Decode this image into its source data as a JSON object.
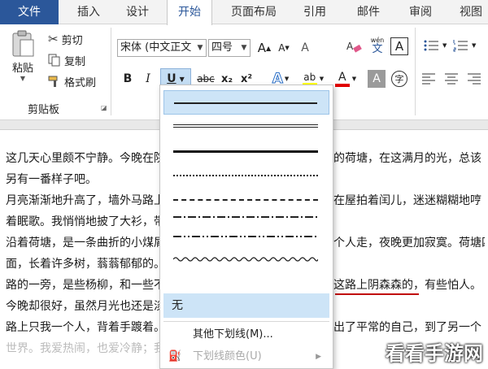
{
  "tabs": {
    "file": "文件",
    "insert": "插入",
    "design": "设计",
    "home": "开始",
    "layout": "页面布局",
    "references": "引用",
    "mailings": "邮件",
    "review": "审阅",
    "view": "视图"
  },
  "clipboard": {
    "paste": "粘贴",
    "cut": "剪切",
    "copy": "复制",
    "format_painter": "格式刷",
    "group_label": "剪贴板"
  },
  "font": {
    "name": "宋体 (中文正文",
    "size": "四号",
    "bold": "B",
    "italic": "I",
    "underline": "U",
    "strike": "abc",
    "sub": "x₂",
    "sup": "x²",
    "grow": "A",
    "shrink": "A",
    "text_a": "A",
    "wen": "wén",
    "wen_char": "文",
    "border_a": "A",
    "shade_a": "A",
    "circle_char": "字",
    "effects_a": "A",
    "highlight_a": "ab",
    "color_a": "A"
  },
  "colors": {
    "accent": "#2b579a",
    "underline_red": "#c00000",
    "hover": "#cde4f7",
    "highlight": "#ffff00",
    "font_red": "#e00000"
  },
  "underline_menu": {
    "none": "无",
    "more": "其他下划线(M)...",
    "color": "下划线颜色(U)"
  },
  "document": {
    "lines": [
      {
        "a": "这几天心里颇不宁静。今晚在院",
        "b": "的荷塘，在这满月的光，总该"
      },
      {
        "a": "另有一番样子吧。",
        "b": ""
      },
      {
        "a": "月亮渐渐地升高了，墙外马路上",
        "b": "在屋拍着闰儿，迷迷糊糊地哼"
      },
      {
        "a": "着眠歌。我悄悄地披了大衫，带",
        "b": ""
      },
      {
        "a": "沿着荷塘，是一条曲折的小煤屑",
        "b": "个人走，夜晚更加寂寞。荷塘四"
      },
      {
        "a": "面，长着许多树，蓊蓊郁郁的。",
        "b": ""
      },
      {
        "a": "路的一旁，是些杨柳，和一些不",
        "b": "这路上阴森森的，有些怕人。"
      },
      {
        "a": "今晚却很好，虽然月光也还是淡",
        "b": ""
      },
      {
        "a": "路上只我一个人，背着手踱着。",
        "b": "出了平常的自己，到了另一个"
      },
      {
        "a": "世界。我爱热闹，也爱冷静；我",
        "b": ""
      }
    ]
  },
  "watermark": "看看手游网"
}
